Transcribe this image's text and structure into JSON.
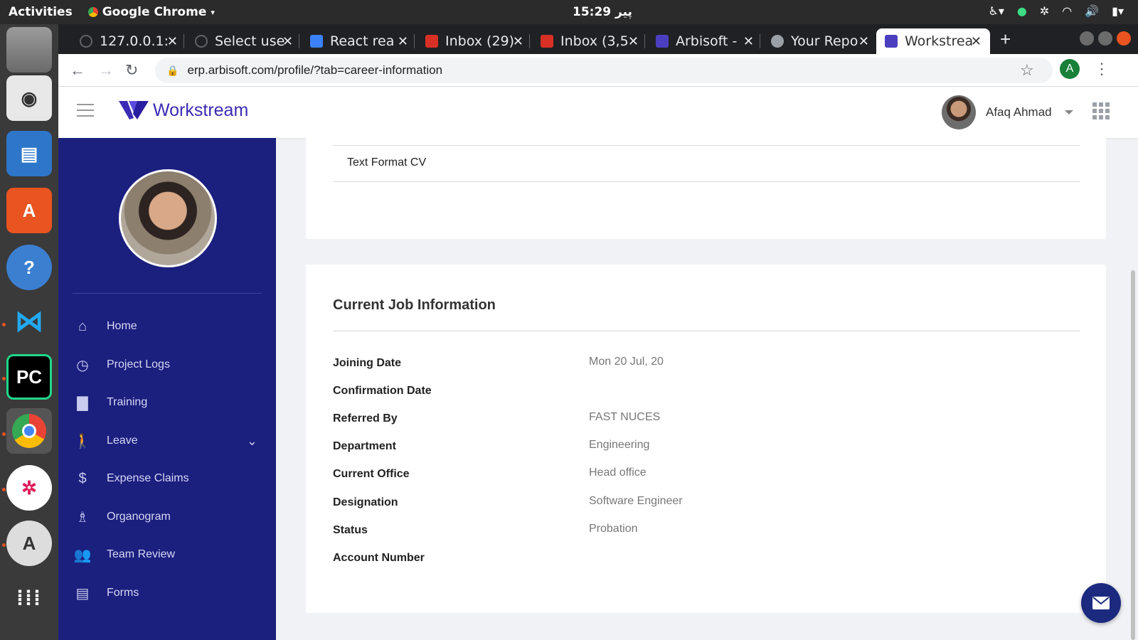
{
  "os": {
    "activities": "Activities",
    "app_menu": "Google Chrome",
    "clock": "پیر 15:29"
  },
  "browser": {
    "tabs": [
      {
        "label": "127.0.0.1:",
        "favicon_color": "#5f6368"
      },
      {
        "label": "Select use",
        "favicon_color": "#5f6368"
      },
      {
        "label": "React rea",
        "favicon_color": "#3b82f6"
      },
      {
        "label": "Inbox (29)",
        "favicon_color": "#d93025"
      },
      {
        "label": "Inbox (3,5",
        "favicon_color": "#d93025"
      },
      {
        "label": "Arbisoft -",
        "favicon_color": "#4c3fbf"
      },
      {
        "label": "Your Repo",
        "favicon_color": "#9aa0a6"
      },
      {
        "label": "Workstrea",
        "favicon_color": "#4c3fbf"
      }
    ],
    "url": "erp.arbisoft.com/profile/?tab=career-information",
    "profile_initial": "A"
  },
  "app": {
    "brand": "Workstream",
    "user_name": "Afaq Ahmad"
  },
  "sidebar": {
    "items": [
      {
        "label": "Home",
        "icon": "home-icon",
        "glyph": "⌂"
      },
      {
        "label": "Project Logs",
        "icon": "clock-icon",
        "glyph": "◷"
      },
      {
        "label": "Training",
        "icon": "presentation-icon",
        "glyph": "▇"
      },
      {
        "label": "Leave",
        "icon": "walking-icon",
        "glyph": "🚶"
      },
      {
        "label": "Expense Claims",
        "icon": "dollar-icon",
        "glyph": "$"
      },
      {
        "label": "Organogram",
        "icon": "org-chart-icon",
        "glyph": "♗"
      },
      {
        "label": "Team Review",
        "icon": "team-icon",
        "glyph": "👥"
      },
      {
        "label": "Forms",
        "icon": "document-icon",
        "glyph": "▤"
      }
    ]
  },
  "cv": {
    "text_format": "Text Format CV"
  },
  "job_info": {
    "title": "Current Job Information",
    "rows": [
      {
        "label": "Joining Date",
        "value": "Mon 20 Jul, 20"
      },
      {
        "label": "Confirmation Date",
        "value": ""
      },
      {
        "label": "Referred By",
        "value": "FAST NUCES"
      },
      {
        "label": "Department",
        "value": "Engineering"
      },
      {
        "label": "Current Office",
        "value": "Head office"
      },
      {
        "label": "Designation",
        "value": "Software Engineer"
      },
      {
        "label": "Status",
        "value": "Probation"
      },
      {
        "label": "Account Number",
        "value": ""
      }
    ]
  },
  "colors": {
    "sidebar_bg": "#1b1f7e",
    "brand": "#3b2bb5",
    "chrome_dark": "#202124"
  }
}
